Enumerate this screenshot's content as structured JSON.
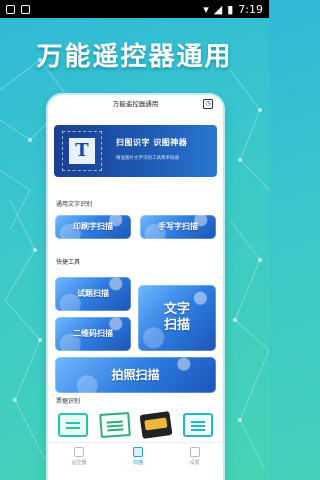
{
  "status": {
    "time": "7:19"
  },
  "hero_title": "万能遥控器通用",
  "app": {
    "title": "万能遥控器通用",
    "banner": {
      "icon_letter": "T",
      "title": "扫图识字  识图神器",
      "subtitle": "精准图片文字识别工具简单快速"
    },
    "sections": {
      "text_recognition": "通用文字识别",
      "quick_tools": "快捷工具",
      "ticket_recognition": "票据识别"
    },
    "buttons": {
      "print_scan": "印刷字扫描",
      "hand_scan": "手写字扫描",
      "exam_scan": "试题扫描",
      "qr_scan": "二维码扫描",
      "text_scan_line1": "文字",
      "text_scan_line2": "扫描",
      "photo_scan": "拍照扫描"
    },
    "tabs": [
      {
        "label": "遥控器",
        "active": false
      },
      {
        "label": "扫描",
        "active": true
      },
      {
        "label": "设置",
        "active": false
      }
    ]
  },
  "colors": {
    "accent": "#2f9ad8",
    "banner": "#1f4aa5"
  }
}
